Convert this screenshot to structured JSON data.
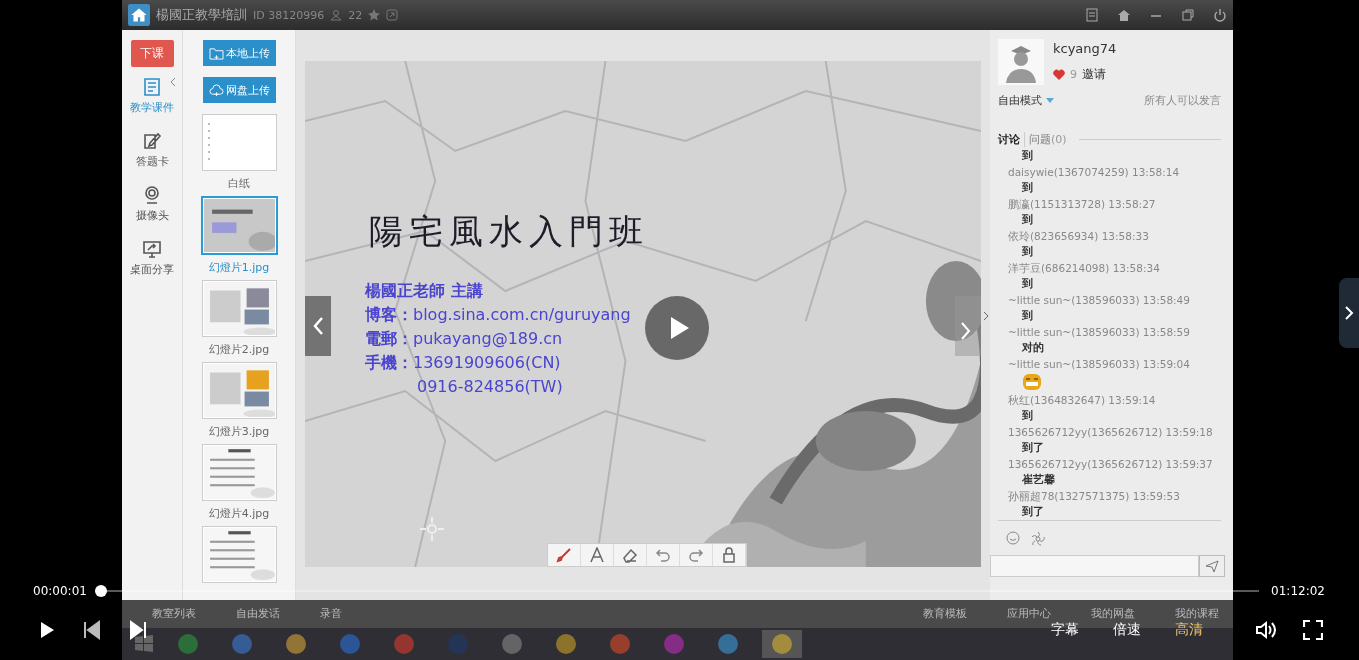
{
  "app": {
    "title": "楊國正教學培訓",
    "room_id": "ID 38120996",
    "online_count": "22"
  },
  "nav": {
    "end_class": "下课",
    "items": [
      {
        "label": "教学课件",
        "selected": true,
        "kind": "courseware"
      },
      {
        "label": "答题卡",
        "selected": false,
        "kind": "answer"
      },
      {
        "label": "摄像头",
        "selected": false,
        "kind": "camera"
      },
      {
        "label": "桌面分享",
        "selected": false,
        "kind": "desktop"
      }
    ]
  },
  "files": {
    "buttons": [
      {
        "label": "本地上传",
        "kind": "folder"
      },
      {
        "label": "网盘上传",
        "kind": "cloud"
      }
    ],
    "slides": [
      {
        "label": "白纸",
        "selected": false,
        "kind": "blank"
      },
      {
        "label": "幻燈片1.jpg",
        "selected": true,
        "kind": "title"
      },
      {
        "label": "幻燈片2.jpg",
        "selected": false
      },
      {
        "label": "幻燈片3.jpg",
        "selected": false
      },
      {
        "label": "幻燈片4.jpg",
        "selected": false,
        "kind": "list"
      },
      {
        "selected": false,
        "kind": "list"
      }
    ]
  },
  "slide": {
    "title": "陽宅風水入門班",
    "lines": [
      {
        "label": "楊國正老師 主講"
      },
      {
        "label": "博客：",
        "value": "blog.sina.com.cn/guruyang"
      },
      {
        "label": "電郵：",
        "value": "pukayang@189.cn"
      },
      {
        "label": "手機：",
        "value": "13691909606(CN)"
      },
      {
        "value": "0916-824856(TW)"
      }
    ]
  },
  "profile": {
    "username": "kcyang74",
    "likes": "9",
    "invite": "邀请",
    "mode": "自由模式",
    "permission": "所有人可以发言"
  },
  "chat": {
    "tabs": [
      {
        "label": "讨论",
        "selected": true
      },
      {
        "label": "问题",
        "count": "(0)",
        "selected": false
      }
    ],
    "messages": [
      {
        "kind": "text",
        "text": "到",
        "meta": "daisywie(1367074259) 13:58:14"
      },
      {
        "kind": "text",
        "text": "到",
        "meta": "鹏瀛(1151313728) 13:58:27"
      },
      {
        "kind": "text",
        "text": "到",
        "meta": "依玲(823656934) 13:58:33"
      },
      {
        "kind": "text",
        "text": "到",
        "meta": "洋芋豆(686214098) 13:58:34"
      },
      {
        "kind": "text",
        "text": "到",
        "meta": "~little sun~(138596033) 13:58:49"
      },
      {
        "kind": "text",
        "text": "到",
        "meta": "~little sun~(138596033) 13:58:59"
      },
      {
        "kind": "text",
        "text": "对的",
        "meta": "~little sun~(138596033) 13:59:04"
      },
      {
        "kind": "emoji",
        "meta": "秋红(1364832647) 13:59:14"
      },
      {
        "kind": "text",
        "text": "到",
        "meta": "1365626712yy(1365626712) 13:59:18"
      },
      {
        "kind": "text",
        "text": "到了",
        "meta": "1365626712yy(1365626712) 13:59:37"
      },
      {
        "kind": "text",
        "text": "崔艺馨",
        "meta": "孙丽超78(1327571375) 13:59:53"
      },
      {
        "kind": "text",
        "text": "到了"
      }
    ]
  },
  "bottom_toolbar": {
    "left": [
      "教室列表",
      "自由发话",
      "录音"
    ],
    "right": [
      "教育模板",
      "应用中心",
      "我的网盘",
      "我的课程"
    ]
  },
  "player": {
    "current_time": "00:00:01",
    "total_time": "01:12:02",
    "level": 0.0,
    "options": [
      {
        "label": "字幕",
        "selected": false
      },
      {
        "label": "倍速",
        "selected": false
      },
      {
        "label": "高清",
        "selected": true
      }
    ]
  }
}
